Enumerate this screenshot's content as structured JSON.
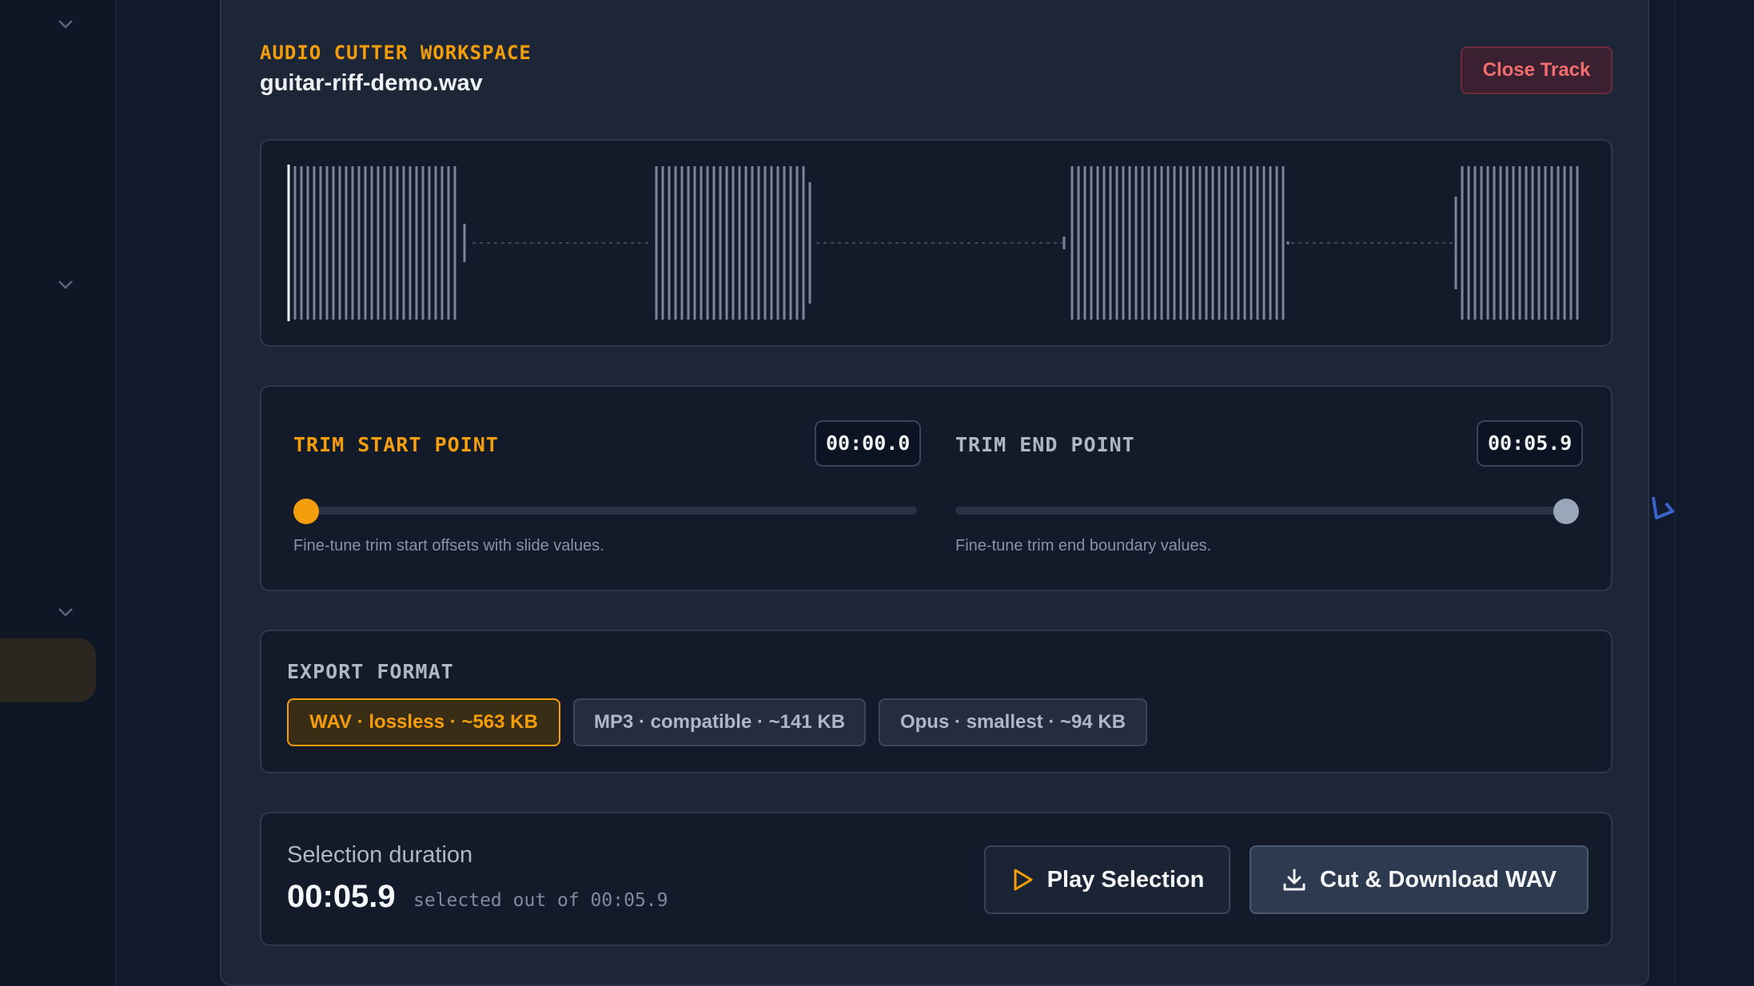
{
  "panel": {
    "workspace_label": "AUDIO CUTTER WORKSPACE",
    "file_name": "guitar-riff-demo.wav",
    "close_label": "Close Track"
  },
  "trim": {
    "start": {
      "label": "TRIM START POINT",
      "value": "00:00.0",
      "hint": "Fine-tune trim start offsets with slide values.",
      "fraction": 0.0
    },
    "end": {
      "label": "TRIM END POINT",
      "value": "00:05.9",
      "hint": "Fine-tune trim end boundary values.",
      "fraction": 1.0
    }
  },
  "export": {
    "label": "EXPORT FORMAT",
    "options": [
      {
        "label": "WAV · lossless · ~563 KB",
        "selected": true
      },
      {
        "label": "MP3 · compatible · ~141 KB",
        "selected": false
      },
      {
        "label": "Opus · smallest · ~94 KB",
        "selected": false
      }
    ]
  },
  "selection": {
    "label": "Selection duration",
    "duration": "00:05.9",
    "note": "selected out of 00:05.9"
  },
  "actions": {
    "play_label": "Play Selection",
    "cut_label": "Cut & Download WAV"
  },
  "colors": {
    "accent": "#f59e0b",
    "danger": "#f26d6d",
    "end_thumb": "#9aa6b9"
  }
}
